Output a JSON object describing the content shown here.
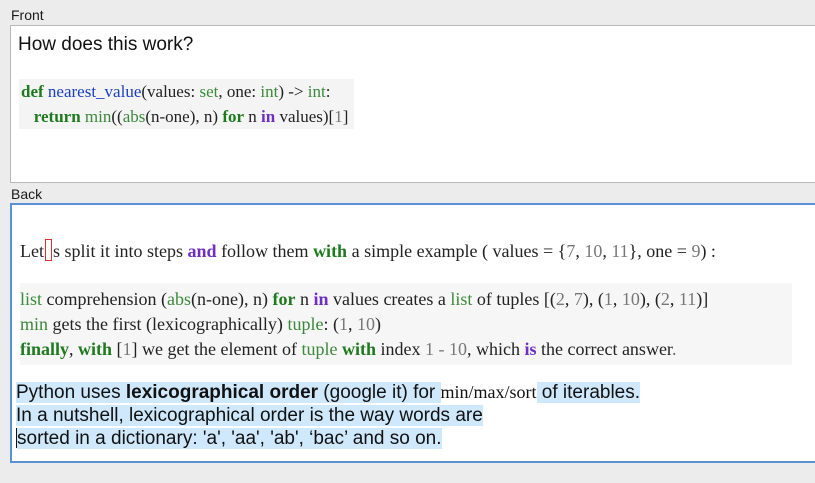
{
  "front": {
    "label": "Front",
    "question": "How does this work?",
    "code": {
      "line1": {
        "def": "def",
        "fname": "nearest_value",
        "p1": "(values: ",
        "set": "set",
        "p2": ", one: ",
        "int1": "int",
        "p3": ") -> ",
        "int2": "int",
        "p4": ":"
      },
      "line2": {
        "indent": "   ",
        "ret": "return",
        "sp": " ",
        "min": "min",
        "p1": "((",
        "abs": "abs",
        "p2": "(n-one), n) ",
        "for": "for",
        "p3": " n ",
        "in": "in",
        "p4": " values)[",
        "idx": "1",
        "p5": "]"
      }
    }
  },
  "back": {
    "label": "Back",
    "intro": {
      "a": "Let",
      "b": "s split it into steps ",
      "and": "and",
      "c": " follow them ",
      "with": "with",
      "d": " a simple example ( values = {",
      "n1": "7",
      "e": ", ",
      "n2": "10",
      "f": ", ",
      "n3": "11",
      "g": "}, one = ",
      "n4": "9",
      "h": ") :"
    },
    "step1": {
      "list": "list",
      "a": " comprehension (",
      "abs": "abs",
      "b": "(n-one), n) ",
      "for": "for",
      "c": " n ",
      "in": "in",
      "d": " values creates a ",
      "list2": "list",
      "e": " of tuples [(",
      "t1": "2",
      "f": ", ",
      "t2": "7",
      "g": "), (",
      "t3": "1",
      "h": ", ",
      "t4": "10",
      "i": "), (",
      "t5": "2",
      "j": ", ",
      "t6": "11",
      "k": ")]"
    },
    "step2": {
      "min": "min",
      "a": " gets the first (lexicographically) ",
      "tuple": "tuple",
      "b": ": (",
      "n1": "1",
      "c": ", ",
      "n2": "10",
      "d": ")"
    },
    "step3": {
      "finally": "finally",
      "a": ", ",
      "with": "with",
      "b": " [",
      "n1": "1",
      "c": "] we get the element of ",
      "tuple": "tuple",
      "d": " ",
      "with2": "with",
      "e": " index ",
      "expr": "1 - 10",
      "f": ", which ",
      "is": "is",
      "g": " the correct answer",
      "dot": "."
    },
    "summary": {
      "l1a": "Python uses ",
      "l1b": "lexicographical order",
      "l1c": " (google it) for ",
      "l1d": "min/max/sort",
      "l1e": " of iterables. ",
      "l2": "In a nutshell, lexicographical order is the way words are ",
      "l3": "sorted in a dictionary: 'a', 'aa', 'ab', ‘bac’ and so on."
    }
  }
}
